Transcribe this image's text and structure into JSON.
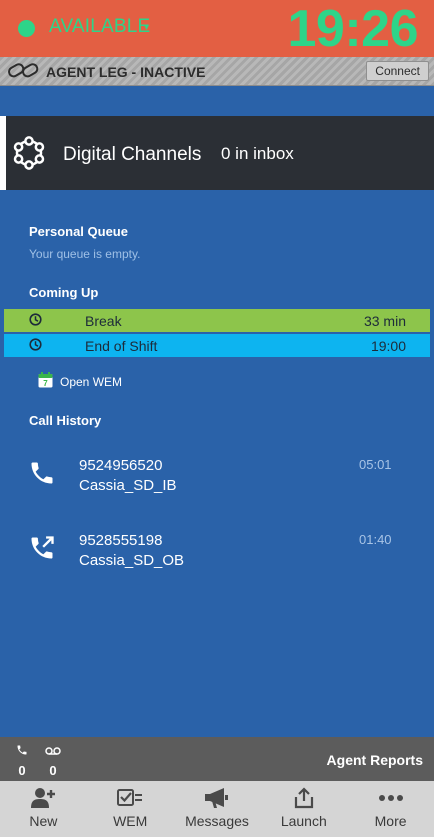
{
  "status": {
    "label": "AVAILABLE",
    "caret": "▾",
    "color": "#2ed489"
  },
  "clock": "19:26",
  "agent_leg": {
    "label": "AGENT LEG - INACTIVE",
    "connect_label": "Connect",
    "icon": "link-broken-icon"
  },
  "digital_channels": {
    "title": "Digital Channels",
    "inbox": "0 in inbox",
    "icon": "network-icon"
  },
  "personal_queue": {
    "heading": "Personal Queue",
    "empty_text": "Your queue is empty."
  },
  "coming_up": {
    "heading": "Coming Up",
    "items": [
      {
        "name": "Break",
        "time": "33 min",
        "color": "#8dc54b",
        "icon": "clock-icon"
      },
      {
        "name": "End of Shift",
        "time": "19:00",
        "color": "#0db4f0",
        "icon": "clock-icon"
      }
    ]
  },
  "open_wem": {
    "label": "Open WEM",
    "icon": "calendar-icon"
  },
  "call_history": {
    "heading": "Call History",
    "calls": [
      {
        "number": "9524956520",
        "name": "Cassia_SD_IB",
        "duration": "05:01",
        "direction": "inbound",
        "icon": "phone-icon"
      },
      {
        "number": "9528555198",
        "name": "Cassia_SD_OB",
        "duration": "01:40",
        "direction": "outbound",
        "icon": "phone-outgoing-icon"
      }
    ]
  },
  "stats": {
    "calls": "0",
    "voicemail": "0",
    "reports_label": "Agent Reports"
  },
  "nav": [
    {
      "label": "New",
      "icon": "add-user-icon"
    },
    {
      "label": "WEM",
      "icon": "checklist-icon"
    },
    {
      "label": "Messages",
      "icon": "megaphone-icon"
    },
    {
      "label": "Launch",
      "icon": "share-icon"
    },
    {
      "label": "More",
      "icon": "more-icon"
    }
  ]
}
